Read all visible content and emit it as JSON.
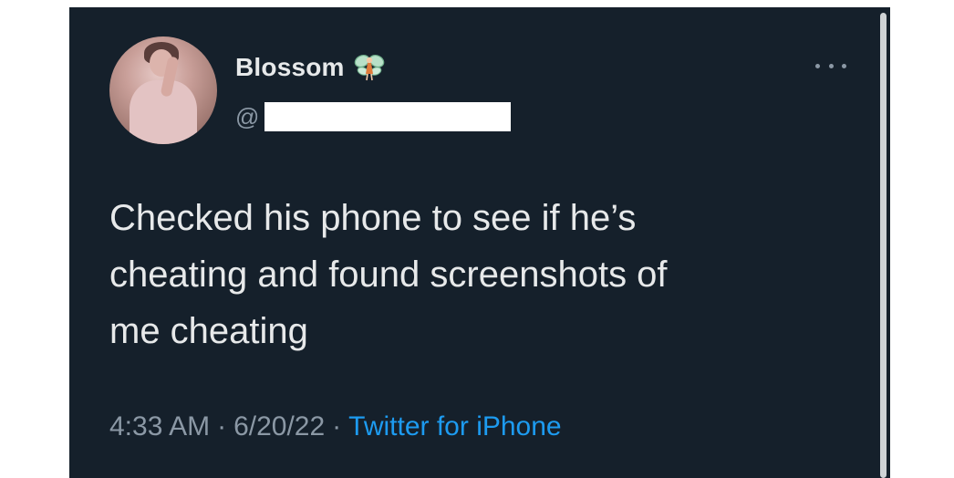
{
  "tweet": {
    "display_name": "Blossom",
    "handle_prefix": "@",
    "name_badge_icon": "fairy-icon",
    "more_icon": "more-options-icon",
    "text": "Checked his phone to see if he’s\ncheating and found screenshots of\nme cheating",
    "time": "4:33 AM",
    "date": "6/20/22",
    "separator": "·",
    "source": "Twitter for iPhone"
  },
  "colors": {
    "background": "#15202b",
    "primary_text": "#e7e9ea",
    "secondary_text": "#8b98a5",
    "link": "#1d9bf0",
    "redaction": "#ffffff"
  }
}
